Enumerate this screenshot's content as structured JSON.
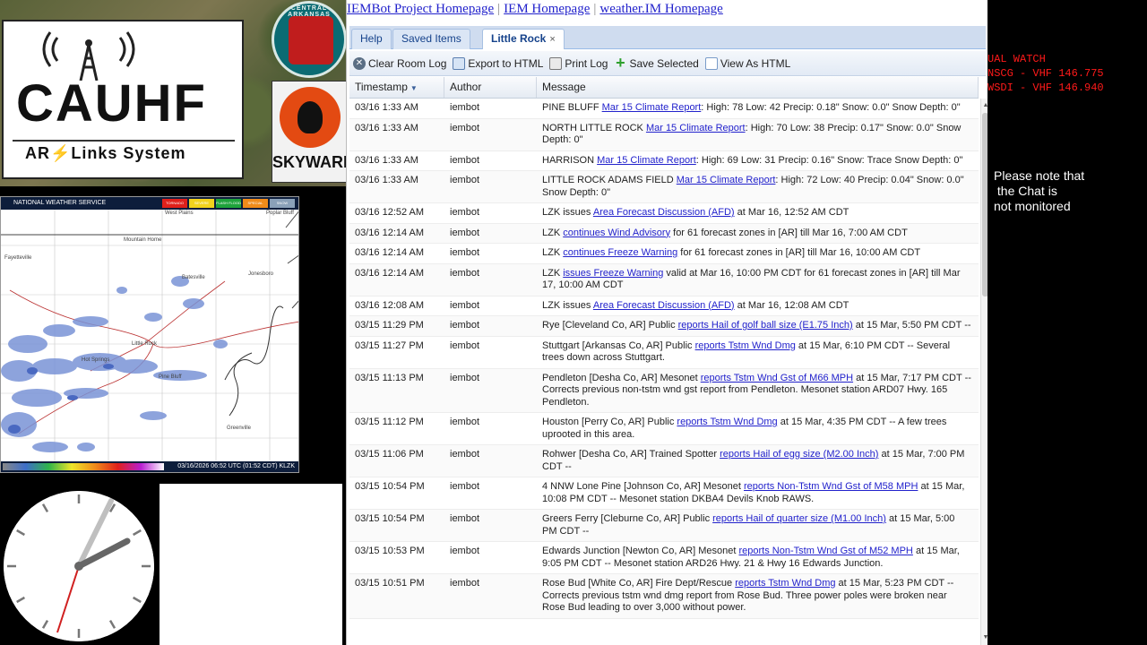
{
  "logos": {
    "cauhf_title": "CAUHF",
    "cauhf_subtitle_a": "AR",
    "cauhf_subtitle_b": "Links System",
    "aresd_ring": "CENTRAL ARKANSAS",
    "skywarn": "SKYWARN"
  },
  "radar": {
    "header": "NATIONAL WEATHER SERVICE",
    "legend_keys": [
      "TORNADO",
      "SEVERE THUNDERSTORM",
      "FLASH FLOOD",
      "SPECIAL MARINE",
      "SNOW SQUALL"
    ],
    "legend_colors": [
      "#e0201b",
      "#f2d21d",
      "#1fa33b",
      "#f08b1a",
      "#8aa0b8"
    ],
    "footer": "03/16/2026 06:52 UTC (01:52 CDT)  KLZK",
    "places": [
      "West Plains",
      "Poplar Bluff",
      "Mountain Home",
      "Fayetteville",
      "Batesville",
      "Jonesboro",
      "Little Rock",
      "Hot Springs",
      "Pine Bluff",
      "Greenville"
    ]
  },
  "chat": {
    "links": [
      "IEMBot Project Homepage",
      "IEM Homepage",
      "weather.IM Homepage"
    ],
    "tabs": [
      "Help",
      "Saved Items",
      "Little Rock"
    ],
    "tab_close": "×",
    "toolbar": {
      "clear": "Clear Room Log",
      "export": "Export to HTML",
      "print": "Print Log",
      "save": "Save Selected",
      "view": "View As HTML"
    },
    "columns": [
      "Timestamp",
      "Author",
      "Message"
    ],
    "rows": [
      {
        "ts": "03/16 1:33 AM",
        "author": "iembot",
        "pre": "PINE BLUFF ",
        "link": "Mar 15 Climate Report",
        "post": ": High: 78 Low: 42 Precip: 0.18\" Snow: 0.0\" Snow Depth: 0\""
      },
      {
        "ts": "03/16 1:33 AM",
        "author": "iembot",
        "pre": "NORTH LITTLE ROCK ",
        "link": "Mar 15 Climate Report",
        "post": ": High: 70 Low: 38 Precip: 0.17\" Snow: 0.0\" Snow Depth: 0\""
      },
      {
        "ts": "03/16 1:33 AM",
        "author": "iembot",
        "pre": "HARRISON ",
        "link": "Mar 15 Climate Report",
        "post": ": High: 69 Low: 31 Precip: 0.16\" Snow: Trace Snow Depth: 0\""
      },
      {
        "ts": "03/16 1:33 AM",
        "author": "iembot",
        "pre": "LITTLE ROCK ADAMS FIELD ",
        "link": "Mar 15 Climate Report",
        "post": ": High: 72 Low: 40 Precip: 0.04\" Snow: 0.0\" Snow Depth: 0\""
      },
      {
        "ts": "03/16 12:52 AM",
        "author": "iembot",
        "pre": "LZK issues ",
        "link": "Area Forecast Discussion (AFD)",
        "post": " at Mar 16, 12:52 AM CDT"
      },
      {
        "ts": "03/16 12:14 AM",
        "author": "iembot",
        "pre": "LZK ",
        "link": "continues Wind Advisory",
        "post": " for 61 forecast zones in [AR] till Mar 16, 7:00 AM CDT"
      },
      {
        "ts": "03/16 12:14 AM",
        "author": "iembot",
        "pre": "LZK ",
        "link": "continues Freeze Warning",
        "post": " for 61 forecast zones in [AR] till Mar 16, 10:00 AM CDT"
      },
      {
        "ts": "03/16 12:14 AM",
        "author": "iembot",
        "pre": "LZK ",
        "link": "issues Freeze Warning",
        "post": " valid at Mar 16, 10:00 PM CDT for 61 forecast zones in [AR] till Mar 17, 10:00 AM CDT"
      },
      {
        "ts": "03/16 12:08 AM",
        "author": "iembot",
        "pre": "LZK issues ",
        "link": "Area Forecast Discussion (AFD)",
        "post": " at Mar 16, 12:08 AM CDT"
      },
      {
        "ts": "03/15 11:29 PM",
        "author": "iembot",
        "pre": "Rye [Cleveland Co, AR] Public ",
        "link": "reports Hail of golf ball size (E1.75 Inch)",
        "post": " at 15 Mar, 5:50 PM CDT --"
      },
      {
        "ts": "03/15 11:27 PM",
        "author": "iembot",
        "pre": "Stuttgart [Arkansas Co, AR] Public ",
        "link": "reports Tstm Wnd Dmg",
        "post": " at 15 Mar, 6:10 PM CDT -- Several trees down across Stuttgart."
      },
      {
        "ts": "03/15 11:13 PM",
        "author": "iembot",
        "pre": "Pendleton [Desha Co, AR] Mesonet ",
        "link": "reports Tstm Wnd Gst of M66 MPH",
        "post": " at 15 Mar, 7:17 PM CDT -- Corrects previous non-tstm wnd gst report from Pendleton. Mesonet station ARD07 Hwy. 165 Pendleton."
      },
      {
        "ts": "03/15 11:12 PM",
        "author": "iembot",
        "pre": "Houston [Perry Co, AR] Public ",
        "link": "reports Tstm Wnd Dmg",
        "post": " at 15 Mar, 4:35 PM CDT -- A few trees uprooted in this area."
      },
      {
        "ts": "03/15 11:06 PM",
        "author": "iembot",
        "pre": "Rohwer [Desha Co, AR] Trained Spotter ",
        "link": "reports Hail of egg size (M2.00 Inch)",
        "post": " at 15 Mar, 7:00 PM CDT --"
      },
      {
        "ts": "03/15 10:54 PM",
        "author": "iembot",
        "pre": "4 NNW Lone Pine [Johnson Co, AR] Mesonet ",
        "link": "reports Non-Tstm Wnd Gst of M58 MPH",
        "post": " at 15 Mar, 10:08 PM CDT -- Mesonet station DKBA4 Devils Knob RAWS."
      },
      {
        "ts": "03/15 10:54 PM",
        "author": "iembot",
        "pre": "Greers Ferry [Cleburne Co, AR] Public ",
        "link": "reports Hail of quarter size (M1.00 Inch)",
        "post": " at 15 Mar, 5:00 PM CDT --"
      },
      {
        "ts": "03/15 10:53 PM",
        "author": "iembot",
        "pre": "Edwards Junction [Newton Co, AR] Mesonet ",
        "link": "reports Non-Tstm Wnd Gst of M52 MPH",
        "post": " at 15 Mar, 9:05 PM CDT -- Mesonet station ARD26 Hwy. 21 & Hwy 16 Edwards Junction."
      },
      {
        "ts": "03/15 10:51 PM",
        "author": "iembot",
        "pre": "Rose Bud [White Co, AR] Fire Dept/Rescue ",
        "link": "reports Tstm Wnd Dmg",
        "post": " at 15 Mar, 5:23 PM CDT -- Corrects previous tstm wnd dmg report from Rose Bud. Three power poles were broken near Rose Bud leading to over 3,000 without power."
      }
    ]
  },
  "right": {
    "callout": "UAL WATCH\nNSCG - VHF 146.775\nWSDI - VHF 146.940",
    "note": "Please note that\n the Chat is\nnot monitored"
  }
}
